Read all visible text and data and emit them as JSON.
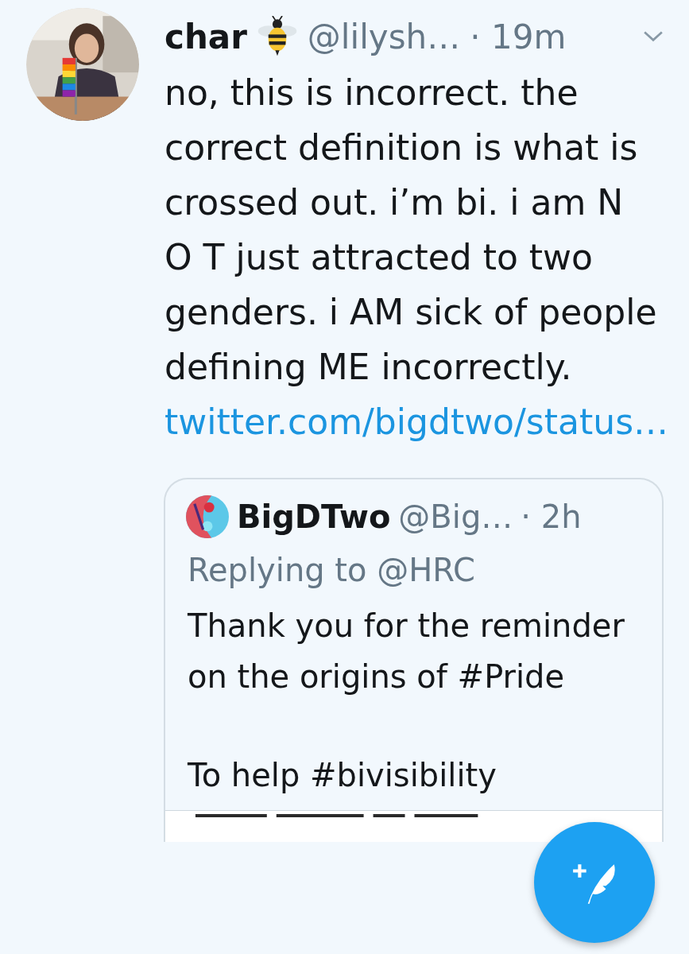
{
  "tweet": {
    "name": "char",
    "handle": "@lilysh…",
    "time": "· 19m",
    "text": "no, this is incorrect. the correct definition is what is crossed out. i’m bi. i am N O T just attracted to two genders. i AM sick of people defining ME incorrectly.",
    "link": "twitter.com/bigdtwo/status…"
  },
  "quoted": {
    "name": "BigDTwo",
    "handle": "@Big…",
    "time": "· 2h",
    "replying": "Replying to @HRC",
    "paragraphs": [
      "Thank you for the reminder on the origins of #Pride",
      "To help #bivisibility"
    ]
  }
}
